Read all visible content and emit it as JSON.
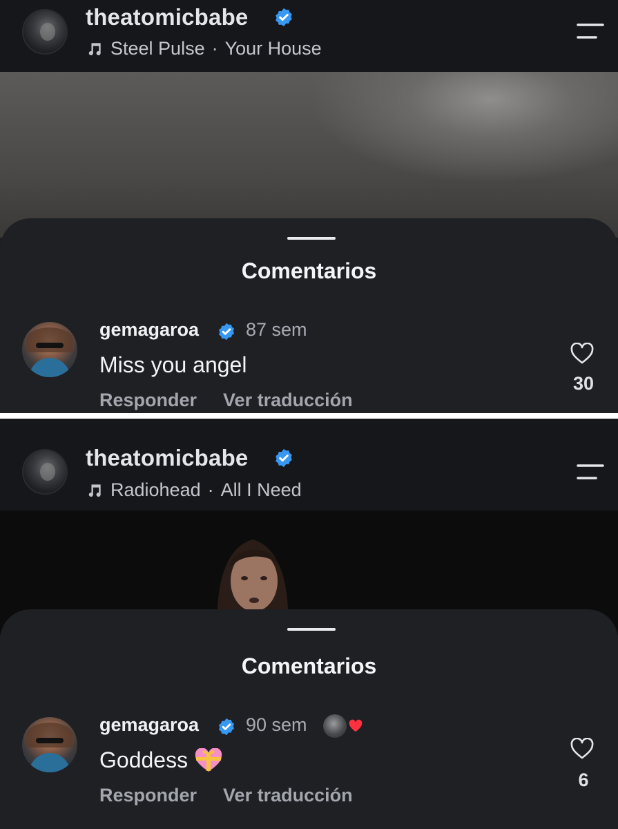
{
  "panels": [
    {
      "header": {
        "username": "theatomicbabe",
        "artist": "Steel Pulse",
        "separator": "·",
        "song": "Your House"
      },
      "sheet_title": "Comentarios",
      "comment": {
        "user": "gemagaroa",
        "time": "87 sem",
        "text": "Miss you angel",
        "reply": "Responder",
        "translate": "Ver traducción",
        "likes": "30"
      }
    },
    {
      "header": {
        "username": "theatomicbabe",
        "artist": "Radiohead",
        "separator": "·",
        "song": "All I Need"
      },
      "sheet_title": "Comentarios",
      "comment": {
        "user": "gemagaroa",
        "time": "90 sem",
        "text": "Goddess",
        "reply": "Responder",
        "translate": "Ver traducción",
        "likes": "6"
      }
    }
  ],
  "icons": {
    "verified": "verified-badge-icon",
    "music": "music-note-icon",
    "menu": "menu-icon",
    "like": "heart-outline-icon",
    "creator_liked": "creator-liked-heart-icon",
    "emoji": "gift-heart-emoji-icon"
  },
  "colors": {
    "verified_blue": "#3897f0",
    "heart_red": "#ff3040",
    "background": "#1b1d21"
  }
}
